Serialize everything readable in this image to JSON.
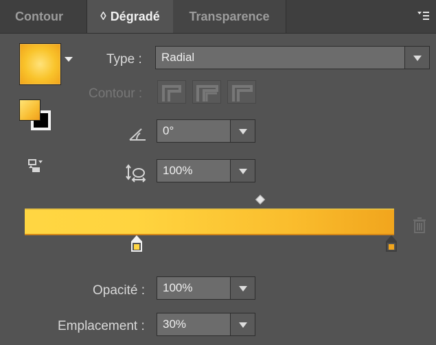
{
  "tabs": [
    {
      "label": "Contour",
      "active": false
    },
    {
      "label": "Dégradé",
      "active": true
    },
    {
      "label": "Transparence",
      "active": false
    }
  ],
  "panel_menu_icon": "panel-menu-icon",
  "type": {
    "label": "Type :",
    "value": "Radial"
  },
  "contour": {
    "label": "Contour :",
    "icons": [
      "stroke-within-icon",
      "stroke-along-icon",
      "stroke-across-icon"
    ]
  },
  "angle": {
    "icon": "angle-icon",
    "value": "0°"
  },
  "aspect_ratio": {
    "icon": "aspect-ratio-icon",
    "value": "100%"
  },
  "reverse_icon": "reverse-gradient-icon",
  "colors": {
    "panel_bg": "#535353",
    "tab_bar_bg": "#3f3f3f",
    "text": "#d9d9d9",
    "gradient_start": "#ffd642",
    "gradient_end": "#f1a51d",
    "left_stop": "#ffd642",
    "right_stop": "#f1a51d"
  },
  "gradient": {
    "midpoint_position": 0.64,
    "stops": [
      {
        "position": 0.3,
        "color": "#ffd642",
        "selected": true
      },
      {
        "position": 1.0,
        "color": "#f1a51d",
        "selected": false
      }
    ]
  },
  "opacity": {
    "label": "Opacité :",
    "value": "100%"
  },
  "location": {
    "label": "Emplacement :",
    "value": "30%"
  }
}
